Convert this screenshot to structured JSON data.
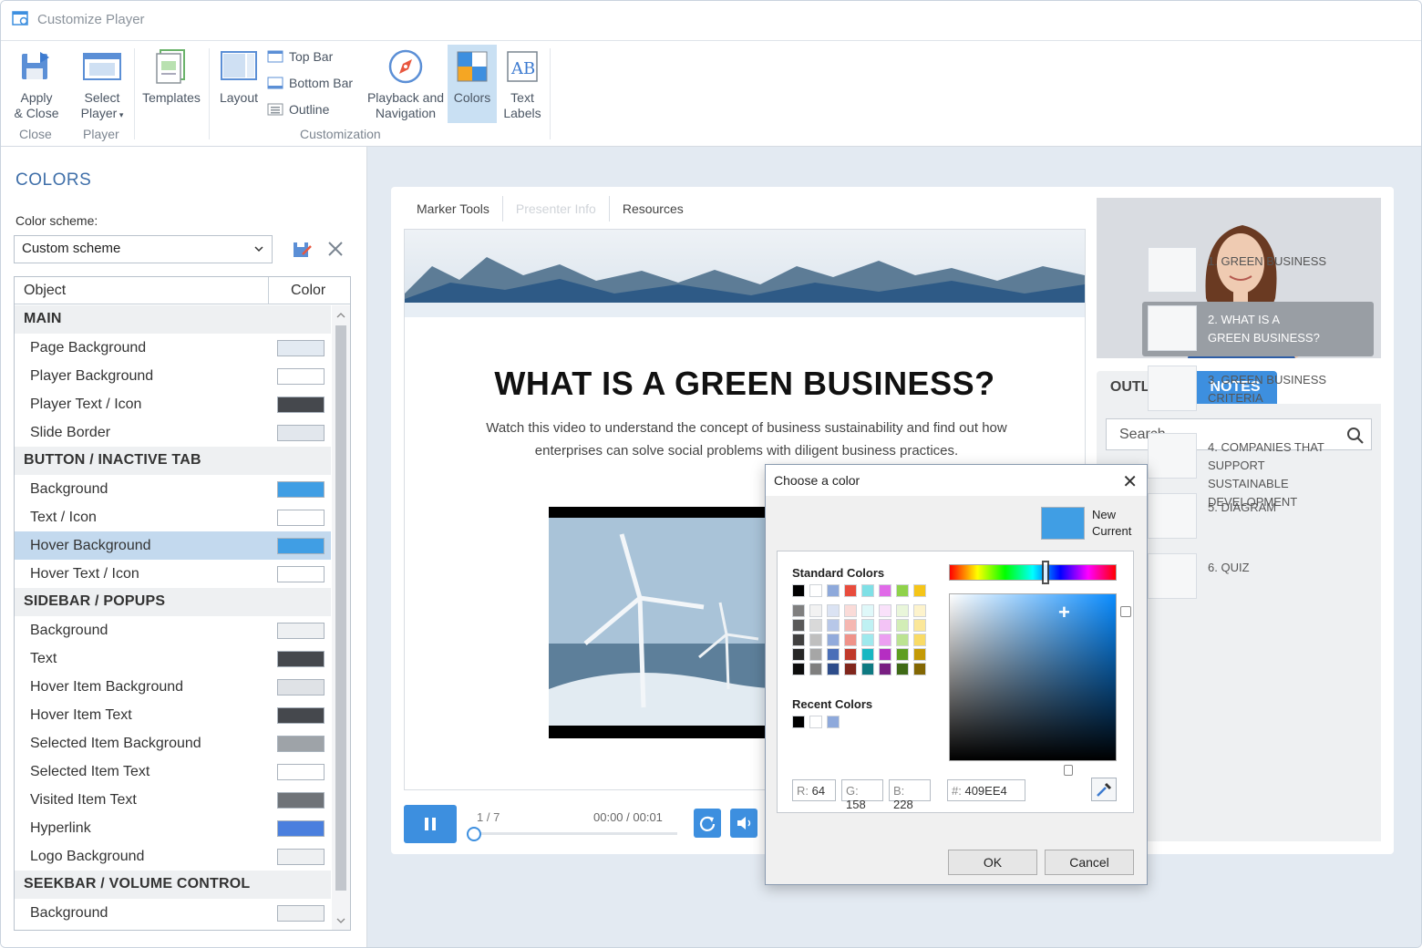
{
  "window": {
    "title": "Customize Player"
  },
  "ribbon": {
    "apply_close": "Apply & Close",
    "apply_line1": "Apply",
    "apply_line2": "& Close",
    "select_player_line1": "Select",
    "select_player_line2": "Player",
    "templates": "Templates",
    "layout": "Layout",
    "top_bar": "Top Bar",
    "bottom_bar": "Bottom Bar",
    "outline": "Outline",
    "playback_line1": "Playback and",
    "playback_line2": "Navigation",
    "colors": "Colors",
    "text_labels_line1": "Text",
    "text_labels_line2": "Labels",
    "groups": {
      "close": "Close",
      "player": "Player",
      "customization": "Customization"
    }
  },
  "colors_panel": {
    "title": "COLORS",
    "scheme_label": "Color scheme:",
    "scheme_value": "Custom scheme",
    "table": {
      "col_object": "Object",
      "col_color": "Color",
      "rows": [
        {
          "type": "header",
          "label": "MAIN"
        },
        {
          "type": "item",
          "label": "Page Background",
          "color": "#e3eaf2"
        },
        {
          "type": "item",
          "label": "Player Background",
          "color": "#ffffff"
        },
        {
          "type": "item",
          "label": "Player Text / Icon",
          "color": "#45484d"
        },
        {
          "type": "item",
          "label": "Slide Border",
          "color": "#e2e7ed"
        },
        {
          "type": "header",
          "label": "BUTTON / INACTIVE TAB"
        },
        {
          "type": "item",
          "label": "Background",
          "color": "#409ee4"
        },
        {
          "type": "item",
          "label": "Text / Icon",
          "color": "#ffffff"
        },
        {
          "type": "item",
          "label": "Hover Background",
          "color": "#409ee4",
          "selected": true
        },
        {
          "type": "item",
          "label": "Hover Text / Icon",
          "color": "#ffffff"
        },
        {
          "type": "header",
          "label": "SIDEBAR / POPUPS"
        },
        {
          "type": "item",
          "label": "Background",
          "color": "#eef0f2"
        },
        {
          "type": "item",
          "label": "Text",
          "color": "#45484d"
        },
        {
          "type": "item",
          "label": "Hover Item Background",
          "color": "#dfe2e6"
        },
        {
          "type": "item",
          "label": "Hover Item Text",
          "color": "#45484d"
        },
        {
          "type": "item",
          "label": "Selected Item Background",
          "color": "#9ea3a8"
        },
        {
          "type": "item",
          "label": "Selected Item Text",
          "color": "#ffffff"
        },
        {
          "type": "item",
          "label": "Visited Item Text",
          "color": "#6f7378"
        },
        {
          "type": "item",
          "label": "Hyperlink",
          "color": "#4a7fde"
        },
        {
          "type": "item",
          "label": "Logo Background",
          "color": "#eef0f2"
        },
        {
          "type": "header",
          "label": "SEEKBAR / VOLUME CONTROL"
        },
        {
          "type": "item",
          "label": "Background",
          "color": "#eef0f2"
        }
      ]
    }
  },
  "player": {
    "tabs": [
      "Marker Tools",
      "Presenter Info",
      "Resources"
    ],
    "slide_title": "WHAT IS A GREEN BUSINESS?",
    "slide_sub_line1": "Watch this video to understand the concept of business sustainability and find out how",
    "slide_sub_line2": "enterprises can solve social problems with diligent business practices.",
    "slide_counter": "1 / 7",
    "time": "00:00  / 00:01",
    "sidebar_tabs": {
      "outline": "OUTLINE",
      "notes": "NOTES"
    },
    "search_placeholder": "Search",
    "outline_items": [
      {
        "line1": "1. GREEN BUSINESS",
        "line2": ""
      },
      {
        "line1": "2. WHAT IS A",
        "line2": "GREEN BUSINESS?"
      },
      {
        "line1": "3. GREEN BUSINESS",
        "line2": "CRITERIA"
      },
      {
        "line1": "4. COMPANIES THAT SUPPORT",
        "line2": "SUSTAINABLE DEVELOPMENT"
      },
      {
        "line1": "5. DIAGRAM",
        "line2": ""
      },
      {
        "line1": "6. QUIZ",
        "line2": ""
      }
    ]
  },
  "color_dialog": {
    "title": "Choose a color",
    "new_label": "New",
    "current_label": "Current",
    "standard_colors_label": "Standard Colors",
    "recent_colors_label": "Recent Colors",
    "r_label": "R:",
    "r_value": "64",
    "g_label": "G:",
    "g_value": "158",
    "b_label": "B:",
    "b_value": "228",
    "hex_label": "#:",
    "hex_value": "409EE4",
    "ok": "OK",
    "cancel": "Cancel",
    "new_color": "#409ee4",
    "standard_top": [
      "#000000",
      "#ffffff",
      "#8ea9db",
      "#e84c3d",
      "#7fe0e6",
      "#e06ae8",
      "#8fd24a",
      "#f5c518"
    ],
    "recent": [
      "#000000",
      "#ffffff",
      "#8ea9db"
    ]
  }
}
